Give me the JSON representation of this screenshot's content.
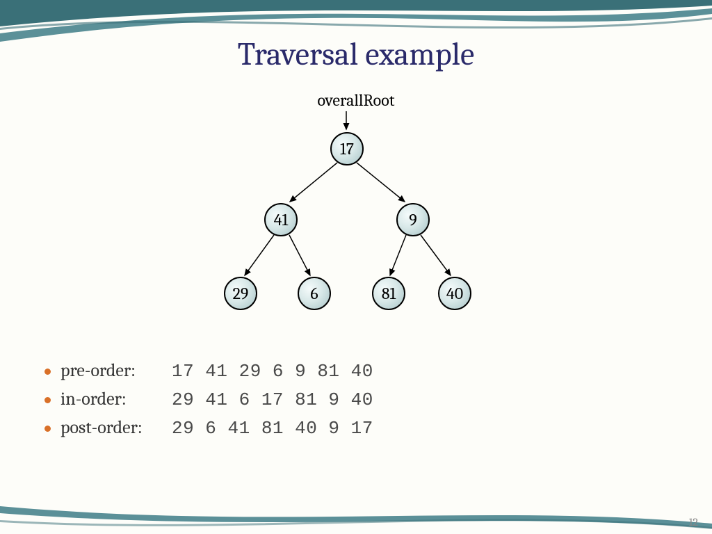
{
  "title": "Traversal example",
  "root_label": "overallRoot",
  "page_number": "12",
  "tree": {
    "nodes": {
      "n17": "17",
      "n41": "41",
      "n9": "9",
      "n29": "29",
      "n6": "6",
      "n81": "81",
      "n40": "40"
    }
  },
  "traversals": [
    {
      "label": "pre-order:",
      "sequence": "17 41 29 6 9 81 40"
    },
    {
      "label": "in-order:",
      "sequence": "29 41 6 17 81 9 40"
    },
    {
      "label": "post-order:",
      "sequence": "29 6 41 81 40 9 17"
    }
  ],
  "colors": {
    "accent": "#5b9098",
    "title": "#2a2a6a",
    "bullet": "#d97028"
  }
}
